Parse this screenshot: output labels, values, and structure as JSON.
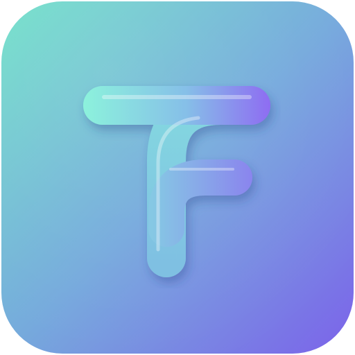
{
  "icon": {
    "glyph": "tf-monogram-icon",
    "colors": {
      "gradient_start": "#6fe0c8",
      "gradient_mid": "#74a9dc",
      "gradient_end": "#7c63ea",
      "stroke_start": "#8cf2dc",
      "stroke_end": "#8e6cf2"
    }
  }
}
